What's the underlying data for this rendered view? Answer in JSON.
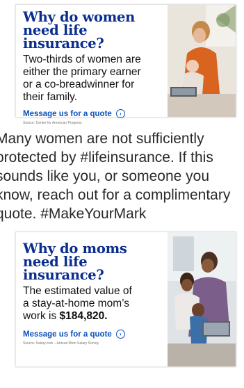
{
  "card1": {
    "title_line1": "Why do women",
    "title_line2": "need life insurance?",
    "body_lines": [
      "Two-thirds of women are",
      "either the primary earner",
      "or a co-breadwinner for",
      "their family."
    ],
    "cta_label": "Message us for a quote",
    "source": "Source: Center for American Progress"
  },
  "caption_lines": [
    "Many women are not sufficiently",
    "protected by #lifeinsurance. If this",
    "sounds like you, or someone you",
    "know, reach out for a complimentary",
    "quote. #MakeYourMark"
  ],
  "card2": {
    "title_line1": "Why do moms",
    "title_line2": "need life insurance?",
    "body_line1": "The estimated value of",
    "body_line2": "a stay-at-home mom’s",
    "body_line3_prefix": "work is ",
    "body_line3_amount": "$184,820.",
    "cta_label": "Message us for a quote",
    "source": "Source: Salary.com – Annual Mom Salary Survey"
  },
  "icons": {
    "cta_icon": "chevron-right-circle-icon"
  }
}
